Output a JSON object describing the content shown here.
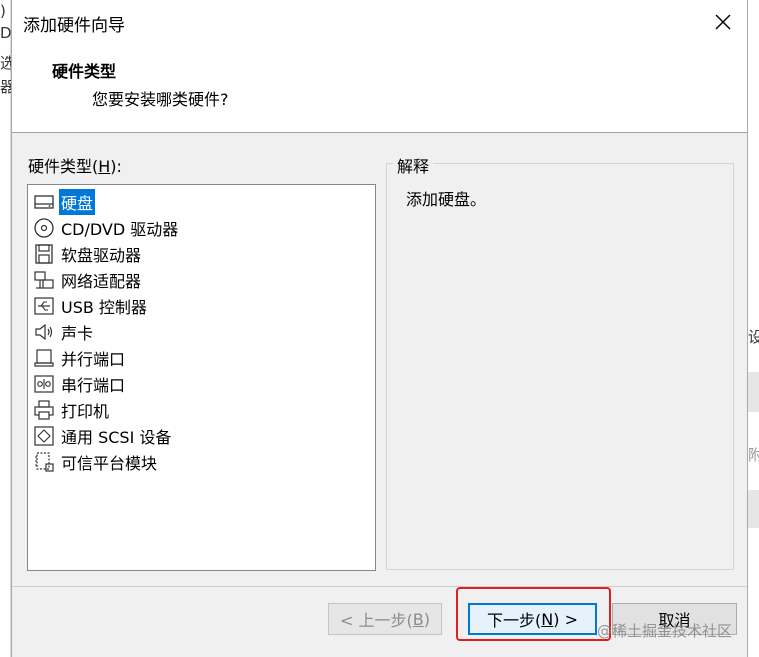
{
  "background": {
    "left_fragments": [
      ")",
      "D",
      "选",
      "器"
    ],
    "right_fragments": [
      "设",
      "附"
    ]
  },
  "dialog": {
    "title": "添加硬件向导",
    "header_title": "硬件类型",
    "header_subtitle": "您要安装哪类硬件?"
  },
  "hardware_types": {
    "label_prefix": "硬件类型(",
    "label_key": "H",
    "label_suffix": "):",
    "selected_index": 0,
    "items": [
      {
        "label": "硬盘",
        "icon": "hard-disk-icon"
      },
      {
        "label": "CD/DVD 驱动器",
        "icon": "cd-dvd-icon"
      },
      {
        "label": "软盘驱动器",
        "icon": "floppy-icon"
      },
      {
        "label": "网络适配器",
        "icon": "network-adapter-icon"
      },
      {
        "label": "USB 控制器",
        "icon": "usb-icon"
      },
      {
        "label": "声卡",
        "icon": "sound-card-icon"
      },
      {
        "label": "并行端口",
        "icon": "parallel-port-icon"
      },
      {
        "label": "串行端口",
        "icon": "serial-port-icon"
      },
      {
        "label": "打印机",
        "icon": "printer-icon"
      },
      {
        "label": "通用 SCSI 设备",
        "icon": "scsi-icon"
      },
      {
        "label": "可信平台模块",
        "icon": "tpm-icon"
      }
    ]
  },
  "explanation": {
    "legend": "解释",
    "text": "添加硬盘。"
  },
  "buttons": {
    "back_prefix": "< 上一步(",
    "back_key": "B",
    "back_suffix": ")",
    "next_prefix": "下一步(",
    "next_key": "N",
    "next_suffix": ") >",
    "cancel": "取消"
  },
  "watermark": "@稀土掘金技术社区",
  "colors": {
    "selection": "#0078d7",
    "highlight": "#e02020",
    "dialog_bg": "#f0f0f0"
  }
}
